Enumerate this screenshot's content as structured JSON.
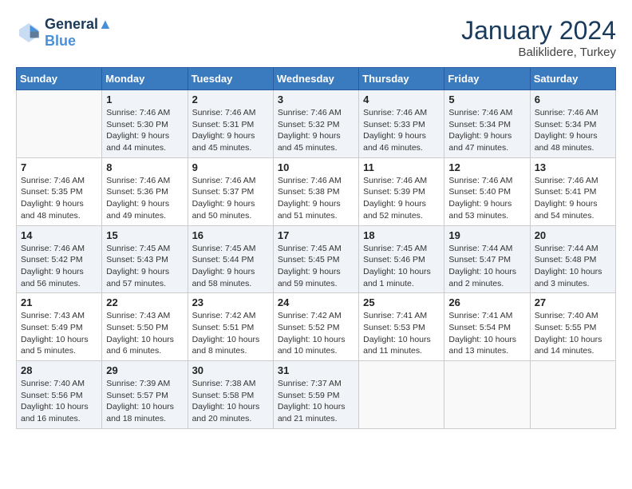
{
  "header": {
    "logo_line1": "General",
    "logo_line2": "Blue",
    "month_year": "January 2024",
    "location": "Baliklidere, Turkey"
  },
  "weekdays": [
    "Sunday",
    "Monday",
    "Tuesday",
    "Wednesday",
    "Thursday",
    "Friday",
    "Saturday"
  ],
  "weeks": [
    [
      {
        "day": "",
        "info": ""
      },
      {
        "day": "1",
        "info": "Sunrise: 7:46 AM\nSunset: 5:30 PM\nDaylight: 9 hours\nand 44 minutes."
      },
      {
        "day": "2",
        "info": "Sunrise: 7:46 AM\nSunset: 5:31 PM\nDaylight: 9 hours\nand 45 minutes."
      },
      {
        "day": "3",
        "info": "Sunrise: 7:46 AM\nSunset: 5:32 PM\nDaylight: 9 hours\nand 45 minutes."
      },
      {
        "day": "4",
        "info": "Sunrise: 7:46 AM\nSunset: 5:33 PM\nDaylight: 9 hours\nand 46 minutes."
      },
      {
        "day": "5",
        "info": "Sunrise: 7:46 AM\nSunset: 5:34 PM\nDaylight: 9 hours\nand 47 minutes."
      },
      {
        "day": "6",
        "info": "Sunrise: 7:46 AM\nSunset: 5:34 PM\nDaylight: 9 hours\nand 48 minutes."
      }
    ],
    [
      {
        "day": "7",
        "info": "Sunrise: 7:46 AM\nSunset: 5:35 PM\nDaylight: 9 hours\nand 48 minutes."
      },
      {
        "day": "8",
        "info": "Sunrise: 7:46 AM\nSunset: 5:36 PM\nDaylight: 9 hours\nand 49 minutes."
      },
      {
        "day": "9",
        "info": "Sunrise: 7:46 AM\nSunset: 5:37 PM\nDaylight: 9 hours\nand 50 minutes."
      },
      {
        "day": "10",
        "info": "Sunrise: 7:46 AM\nSunset: 5:38 PM\nDaylight: 9 hours\nand 51 minutes."
      },
      {
        "day": "11",
        "info": "Sunrise: 7:46 AM\nSunset: 5:39 PM\nDaylight: 9 hours\nand 52 minutes."
      },
      {
        "day": "12",
        "info": "Sunrise: 7:46 AM\nSunset: 5:40 PM\nDaylight: 9 hours\nand 53 minutes."
      },
      {
        "day": "13",
        "info": "Sunrise: 7:46 AM\nSunset: 5:41 PM\nDaylight: 9 hours\nand 54 minutes."
      }
    ],
    [
      {
        "day": "14",
        "info": "Sunrise: 7:46 AM\nSunset: 5:42 PM\nDaylight: 9 hours\nand 56 minutes."
      },
      {
        "day": "15",
        "info": "Sunrise: 7:45 AM\nSunset: 5:43 PM\nDaylight: 9 hours\nand 57 minutes."
      },
      {
        "day": "16",
        "info": "Sunrise: 7:45 AM\nSunset: 5:44 PM\nDaylight: 9 hours\nand 58 minutes."
      },
      {
        "day": "17",
        "info": "Sunrise: 7:45 AM\nSunset: 5:45 PM\nDaylight: 9 hours\nand 59 minutes."
      },
      {
        "day": "18",
        "info": "Sunrise: 7:45 AM\nSunset: 5:46 PM\nDaylight: 10 hours\nand 1 minute."
      },
      {
        "day": "19",
        "info": "Sunrise: 7:44 AM\nSunset: 5:47 PM\nDaylight: 10 hours\nand 2 minutes."
      },
      {
        "day": "20",
        "info": "Sunrise: 7:44 AM\nSunset: 5:48 PM\nDaylight: 10 hours\nand 3 minutes."
      }
    ],
    [
      {
        "day": "21",
        "info": "Sunrise: 7:43 AM\nSunset: 5:49 PM\nDaylight: 10 hours\nand 5 minutes."
      },
      {
        "day": "22",
        "info": "Sunrise: 7:43 AM\nSunset: 5:50 PM\nDaylight: 10 hours\nand 6 minutes."
      },
      {
        "day": "23",
        "info": "Sunrise: 7:42 AM\nSunset: 5:51 PM\nDaylight: 10 hours\nand 8 minutes."
      },
      {
        "day": "24",
        "info": "Sunrise: 7:42 AM\nSunset: 5:52 PM\nDaylight: 10 hours\nand 10 minutes."
      },
      {
        "day": "25",
        "info": "Sunrise: 7:41 AM\nSunset: 5:53 PM\nDaylight: 10 hours\nand 11 minutes."
      },
      {
        "day": "26",
        "info": "Sunrise: 7:41 AM\nSunset: 5:54 PM\nDaylight: 10 hours\nand 13 minutes."
      },
      {
        "day": "27",
        "info": "Sunrise: 7:40 AM\nSunset: 5:55 PM\nDaylight: 10 hours\nand 14 minutes."
      }
    ],
    [
      {
        "day": "28",
        "info": "Sunrise: 7:40 AM\nSunset: 5:56 PM\nDaylight: 10 hours\nand 16 minutes."
      },
      {
        "day": "29",
        "info": "Sunrise: 7:39 AM\nSunset: 5:57 PM\nDaylight: 10 hours\nand 18 minutes."
      },
      {
        "day": "30",
        "info": "Sunrise: 7:38 AM\nSunset: 5:58 PM\nDaylight: 10 hours\nand 20 minutes."
      },
      {
        "day": "31",
        "info": "Sunrise: 7:37 AM\nSunset: 5:59 PM\nDaylight: 10 hours\nand 21 minutes."
      },
      {
        "day": "",
        "info": ""
      },
      {
        "day": "",
        "info": ""
      },
      {
        "day": "",
        "info": ""
      }
    ]
  ]
}
